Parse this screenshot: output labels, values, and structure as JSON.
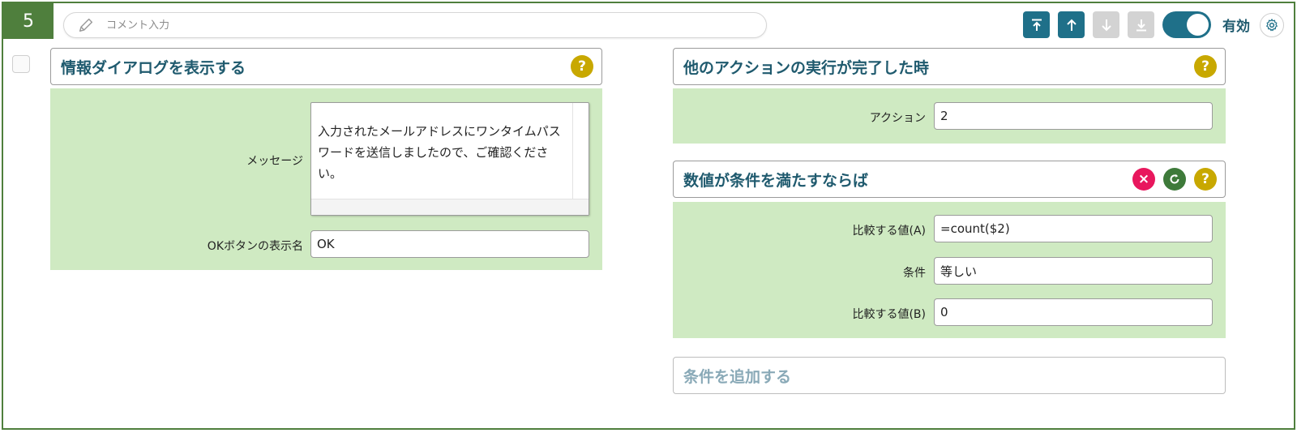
{
  "step": {
    "number": "5"
  },
  "comment": {
    "placeholder": "コメント入力"
  },
  "toolbar": {
    "enabled_label": "有効",
    "enabled": true
  },
  "left_action": {
    "title": "情報ダイアログを表示する",
    "help": "?",
    "fields": {
      "message_label": "メッセージ",
      "message_value": "入力されたメールアドレスにワンタイムパスワードを送信しましたので、ご確認ください。",
      "ok_label": "OKボタンの表示名",
      "ok_value": "OK"
    }
  },
  "trigger": {
    "title": "他のアクションの実行が完了した時",
    "help": "?",
    "action_label": "アクション",
    "action_value": "2"
  },
  "condition": {
    "title": "数値が条件を満たすならば",
    "delete": "×",
    "help": "?",
    "a_label": "比較する値(A)",
    "a_value": "=count($2)",
    "cond_label": "条件",
    "cond_value": "等しい",
    "b_label": "比較する値(B)",
    "b_value": "0"
  },
  "add_condition": {
    "label": "条件を追加する"
  },
  "colors": {
    "accent": "#1f7089",
    "green_frame": "#4f7f3d",
    "panel": "#cfeac2",
    "title": "#1f5a6e"
  }
}
